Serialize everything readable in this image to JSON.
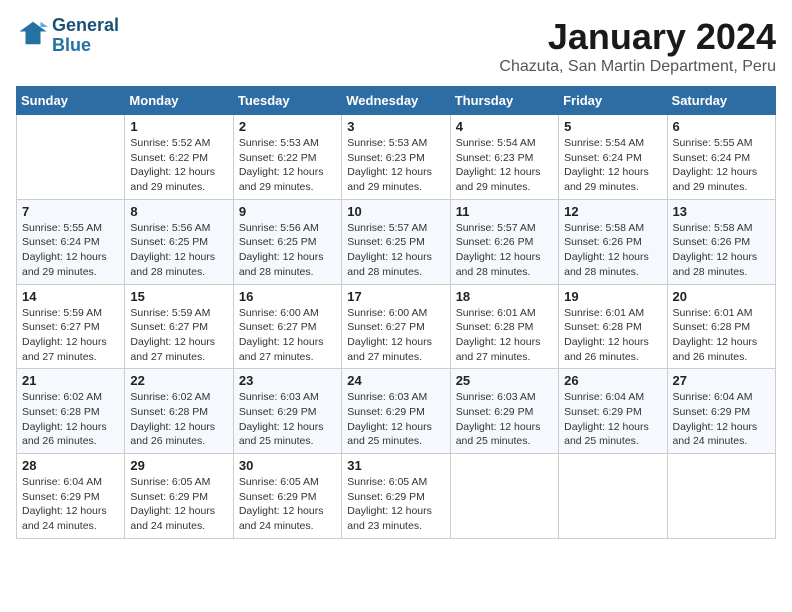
{
  "logo": {
    "line1": "General",
    "line2": "Blue"
  },
  "title": "January 2024",
  "location": "Chazuta, San Martin Department, Peru",
  "days_of_week": [
    "Sunday",
    "Monday",
    "Tuesday",
    "Wednesday",
    "Thursday",
    "Friday",
    "Saturday"
  ],
  "weeks": [
    [
      {
        "day": "",
        "info": ""
      },
      {
        "day": "1",
        "info": "Sunrise: 5:52 AM\nSunset: 6:22 PM\nDaylight: 12 hours\nand 29 minutes."
      },
      {
        "day": "2",
        "info": "Sunrise: 5:53 AM\nSunset: 6:22 PM\nDaylight: 12 hours\nand 29 minutes."
      },
      {
        "day": "3",
        "info": "Sunrise: 5:53 AM\nSunset: 6:23 PM\nDaylight: 12 hours\nand 29 minutes."
      },
      {
        "day": "4",
        "info": "Sunrise: 5:54 AM\nSunset: 6:23 PM\nDaylight: 12 hours\nand 29 minutes."
      },
      {
        "day": "5",
        "info": "Sunrise: 5:54 AM\nSunset: 6:24 PM\nDaylight: 12 hours\nand 29 minutes."
      },
      {
        "day": "6",
        "info": "Sunrise: 5:55 AM\nSunset: 6:24 PM\nDaylight: 12 hours\nand 29 minutes."
      }
    ],
    [
      {
        "day": "7",
        "info": "Sunrise: 5:55 AM\nSunset: 6:24 PM\nDaylight: 12 hours\nand 29 minutes."
      },
      {
        "day": "8",
        "info": "Sunrise: 5:56 AM\nSunset: 6:25 PM\nDaylight: 12 hours\nand 28 minutes."
      },
      {
        "day": "9",
        "info": "Sunrise: 5:56 AM\nSunset: 6:25 PM\nDaylight: 12 hours\nand 28 minutes."
      },
      {
        "day": "10",
        "info": "Sunrise: 5:57 AM\nSunset: 6:25 PM\nDaylight: 12 hours\nand 28 minutes."
      },
      {
        "day": "11",
        "info": "Sunrise: 5:57 AM\nSunset: 6:26 PM\nDaylight: 12 hours\nand 28 minutes."
      },
      {
        "day": "12",
        "info": "Sunrise: 5:58 AM\nSunset: 6:26 PM\nDaylight: 12 hours\nand 28 minutes."
      },
      {
        "day": "13",
        "info": "Sunrise: 5:58 AM\nSunset: 6:26 PM\nDaylight: 12 hours\nand 28 minutes."
      }
    ],
    [
      {
        "day": "14",
        "info": "Sunrise: 5:59 AM\nSunset: 6:27 PM\nDaylight: 12 hours\nand 27 minutes."
      },
      {
        "day": "15",
        "info": "Sunrise: 5:59 AM\nSunset: 6:27 PM\nDaylight: 12 hours\nand 27 minutes."
      },
      {
        "day": "16",
        "info": "Sunrise: 6:00 AM\nSunset: 6:27 PM\nDaylight: 12 hours\nand 27 minutes."
      },
      {
        "day": "17",
        "info": "Sunrise: 6:00 AM\nSunset: 6:27 PM\nDaylight: 12 hours\nand 27 minutes."
      },
      {
        "day": "18",
        "info": "Sunrise: 6:01 AM\nSunset: 6:28 PM\nDaylight: 12 hours\nand 27 minutes."
      },
      {
        "day": "19",
        "info": "Sunrise: 6:01 AM\nSunset: 6:28 PM\nDaylight: 12 hours\nand 26 minutes."
      },
      {
        "day": "20",
        "info": "Sunrise: 6:01 AM\nSunset: 6:28 PM\nDaylight: 12 hours\nand 26 minutes."
      }
    ],
    [
      {
        "day": "21",
        "info": "Sunrise: 6:02 AM\nSunset: 6:28 PM\nDaylight: 12 hours\nand 26 minutes."
      },
      {
        "day": "22",
        "info": "Sunrise: 6:02 AM\nSunset: 6:28 PM\nDaylight: 12 hours\nand 26 minutes."
      },
      {
        "day": "23",
        "info": "Sunrise: 6:03 AM\nSunset: 6:29 PM\nDaylight: 12 hours\nand 25 minutes."
      },
      {
        "day": "24",
        "info": "Sunrise: 6:03 AM\nSunset: 6:29 PM\nDaylight: 12 hours\nand 25 minutes."
      },
      {
        "day": "25",
        "info": "Sunrise: 6:03 AM\nSunset: 6:29 PM\nDaylight: 12 hours\nand 25 minutes."
      },
      {
        "day": "26",
        "info": "Sunrise: 6:04 AM\nSunset: 6:29 PM\nDaylight: 12 hours\nand 25 minutes."
      },
      {
        "day": "27",
        "info": "Sunrise: 6:04 AM\nSunset: 6:29 PM\nDaylight: 12 hours\nand 24 minutes."
      }
    ],
    [
      {
        "day": "28",
        "info": "Sunrise: 6:04 AM\nSunset: 6:29 PM\nDaylight: 12 hours\nand 24 minutes."
      },
      {
        "day": "29",
        "info": "Sunrise: 6:05 AM\nSunset: 6:29 PM\nDaylight: 12 hours\nand 24 minutes."
      },
      {
        "day": "30",
        "info": "Sunrise: 6:05 AM\nSunset: 6:29 PM\nDaylight: 12 hours\nand 24 minutes."
      },
      {
        "day": "31",
        "info": "Sunrise: 6:05 AM\nSunset: 6:29 PM\nDaylight: 12 hours\nand 23 minutes."
      },
      {
        "day": "",
        "info": ""
      },
      {
        "day": "",
        "info": ""
      },
      {
        "day": "",
        "info": ""
      }
    ]
  ]
}
